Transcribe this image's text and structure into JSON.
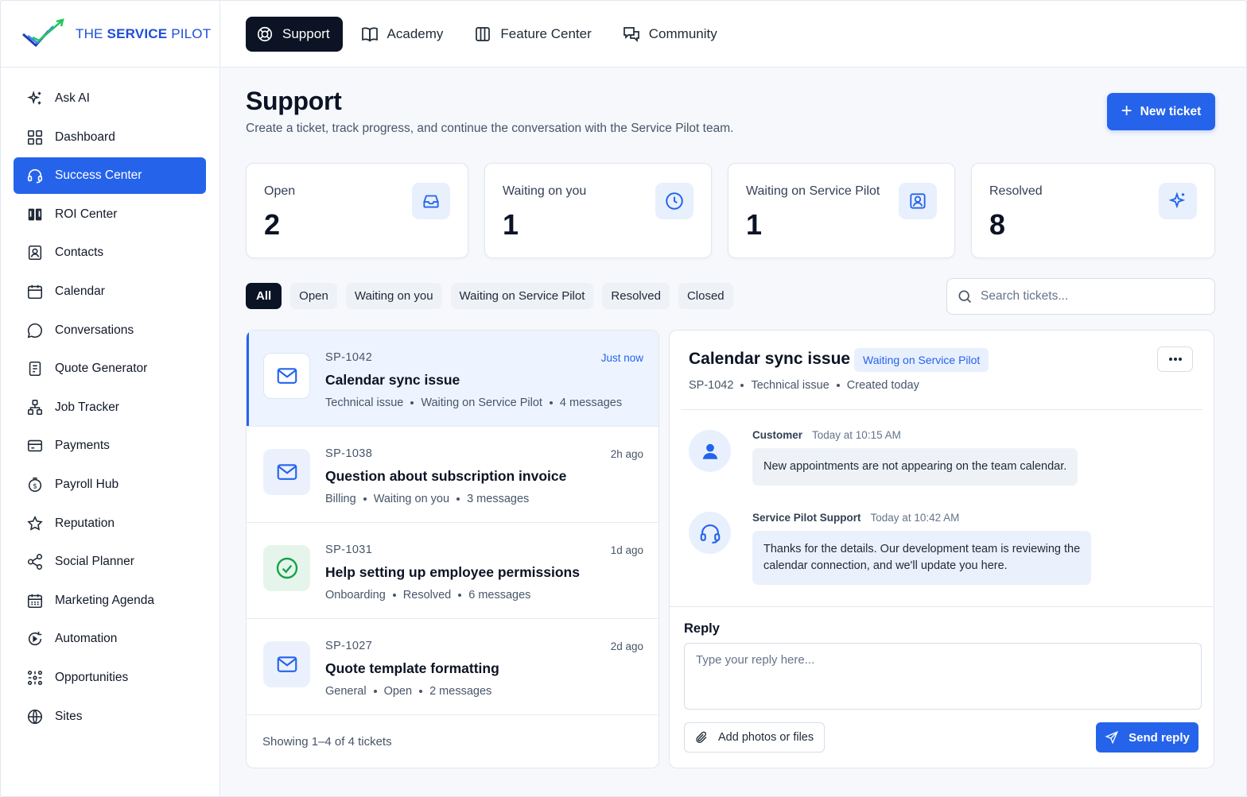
{
  "brand": {
    "name_regular": "THE ",
    "name_bold": "SERVICE",
    "name_tail": " PILOT",
    "accent": "#2563eb"
  },
  "topnav": [
    {
      "label": "Support",
      "icon": "lifebuoy-icon",
      "active": true
    },
    {
      "label": "Academy",
      "icon": "book-icon"
    },
    {
      "label": "Feature Center",
      "icon": "columns-icon"
    },
    {
      "label": "Community",
      "icon": "chat-bubbles-icon"
    }
  ],
  "sidebar": {
    "items": [
      {
        "label": "Ask AI",
        "icon": "sparkles-icon"
      },
      {
        "label": "Dashboard",
        "icon": "grid-icon"
      },
      {
        "label": "Success Center",
        "icon": "headset-icon",
        "active": true
      },
      {
        "label": "ROI Center",
        "icon": "book-open-icon"
      },
      {
        "label": "Contacts",
        "icon": "contact-card-icon"
      },
      {
        "label": "Calendar",
        "icon": "calendar-icon"
      },
      {
        "label": "Conversations",
        "icon": "chat-icon"
      },
      {
        "label": "Quote Generator",
        "icon": "document-icon"
      },
      {
        "label": "Job Tracker",
        "icon": "hierarchy-icon"
      },
      {
        "label": "Payments",
        "icon": "credit-card-icon"
      },
      {
        "label": "Payroll Hub",
        "icon": "dollar-coin-icon"
      },
      {
        "label": "Reputation",
        "icon": "star-icon"
      },
      {
        "label": "Social Planner",
        "icon": "share-icon"
      },
      {
        "label": "Marketing Agenda",
        "icon": "calendar-grid-icon"
      },
      {
        "label": "Automation",
        "icon": "automation-icon"
      },
      {
        "label": "Opportunities",
        "icon": "nodes-icon"
      },
      {
        "label": "Sites",
        "icon": "globe-icon"
      }
    ]
  },
  "page": {
    "title": "Support",
    "subtitle": "Create a ticket, track progress, and continue the conversation with the Service Pilot team.",
    "new_ticket_label": "New ticket"
  },
  "stats": [
    {
      "label": "Open",
      "value": "2",
      "icon": "inbox-icon"
    },
    {
      "label": "Waiting on you",
      "value": "1",
      "icon": "clock-icon"
    },
    {
      "label": "Waiting on Service Pilot",
      "value": "1",
      "icon": "user-badge-icon"
    },
    {
      "label": "Resolved",
      "value": "8",
      "icon": "sparkle-icon"
    }
  ],
  "filters": [
    "All",
    "Open",
    "Waiting on you",
    "Waiting on Service Pilot",
    "Resolved",
    "Closed"
  ],
  "search": {
    "placeholder": "Search tickets..."
  },
  "tickets": [
    {
      "id": "SP-1042",
      "time": "Just now",
      "title": "Calendar sync issue",
      "category": "Technical issue",
      "status": "Waiting on Service Pilot",
      "messages": "4 messages",
      "icon": "mail-icon",
      "selected": true
    },
    {
      "id": "SP-1038",
      "time": "2h ago",
      "title": "Question about subscription invoice",
      "category": "Billing",
      "status": "Waiting on you",
      "messages": "3 messages",
      "icon": "mail-icon"
    },
    {
      "id": "SP-1031",
      "time": "1d ago",
      "title": "Help setting up employee permissions",
      "category": "Onboarding",
      "status": "Resolved",
      "messages": "6 messages",
      "icon": "check-circle-icon"
    },
    {
      "id": "SP-1027",
      "time": "2d ago",
      "title": "Quote template formatting",
      "category": "General",
      "status": "Open",
      "messages": "2 messages",
      "icon": "mail-icon"
    }
  ],
  "list_footer": "Showing 1–4 of 4 tickets",
  "detail": {
    "title": "Calendar sync issue",
    "badge": "Waiting on Service Pilot",
    "id": "SP-1042",
    "category": "Technical issue",
    "created": "Created today",
    "messages": [
      {
        "from": "Customer",
        "time": "Today at 10:15 AM",
        "text": "New appointments are not appearing on the team calendar.",
        "icon": "user-icon"
      },
      {
        "from": "Service Pilot Support",
        "time": "Today at 10:42 AM",
        "text_line1": "Thanks for the details. Our development team is reviewing the",
        "text_line2": "calendar connection, and we'll update you here.",
        "icon": "headset-icon"
      }
    ],
    "reply_label": "Reply",
    "reply_placeholder": "Type your reply here...",
    "attach_label": "Add photos or files",
    "send_label": "Send reply"
  }
}
